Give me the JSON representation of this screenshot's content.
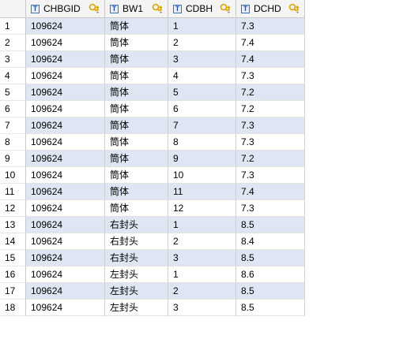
{
  "columns": [
    {
      "label": "CHBGID",
      "type_icon": "T"
    },
    {
      "label": "BW1",
      "type_icon": "T"
    },
    {
      "label": "CDBH",
      "type_icon": "T"
    },
    {
      "label": "DCHD",
      "type_icon": "T"
    }
  ],
  "rows": [
    {
      "num": "1",
      "cells": [
        "109624",
        "筒体",
        "1",
        "7.3"
      ]
    },
    {
      "num": "2",
      "cells": [
        "109624",
        "筒体",
        "2",
        "7.4"
      ]
    },
    {
      "num": "3",
      "cells": [
        "109624",
        "筒体",
        "3",
        "7.4"
      ]
    },
    {
      "num": "4",
      "cells": [
        "109624",
        "筒体",
        "4",
        "7.3"
      ]
    },
    {
      "num": "5",
      "cells": [
        "109624",
        "筒体",
        "5",
        "7.2"
      ]
    },
    {
      "num": "6",
      "cells": [
        "109624",
        "筒体",
        "6",
        "7.2"
      ]
    },
    {
      "num": "7",
      "cells": [
        "109624",
        "筒体",
        "7",
        "7.3"
      ]
    },
    {
      "num": "8",
      "cells": [
        "109624",
        "筒体",
        "8",
        "7.3"
      ]
    },
    {
      "num": "9",
      "cells": [
        "109624",
        "筒体",
        "9",
        "7.2"
      ]
    },
    {
      "num": "10",
      "cells": [
        "109624",
        "筒体",
        "10",
        "7.3"
      ]
    },
    {
      "num": "11",
      "cells": [
        "109624",
        "筒体",
        "11",
        "7.4"
      ]
    },
    {
      "num": "12",
      "cells": [
        "109624",
        "筒体",
        "12",
        "7.3"
      ]
    },
    {
      "num": "13",
      "cells": [
        "109624",
        "右封头",
        "1",
        "8.5"
      ]
    },
    {
      "num": "14",
      "cells": [
        "109624",
        "右封头",
        "2",
        "8.4"
      ]
    },
    {
      "num": "15",
      "cells": [
        "109624",
        "右封头",
        "3",
        "8.5"
      ]
    },
    {
      "num": "16",
      "cells": [
        "109624",
        "左封头",
        "1",
        "8.6"
      ]
    },
    {
      "num": "17",
      "cells": [
        "109624",
        "左封头",
        "2",
        "8.5"
      ]
    },
    {
      "num": "18",
      "cells": [
        "109624",
        "左封头",
        "3",
        "8.5"
      ]
    }
  ],
  "colors": {
    "stripe": "#dde6f2",
    "header_bg": "#f4f4f4",
    "icon_accent": "#d9a400"
  },
  "icons": {
    "type": "text-type-icon",
    "sort": "sort-filter-icon"
  }
}
